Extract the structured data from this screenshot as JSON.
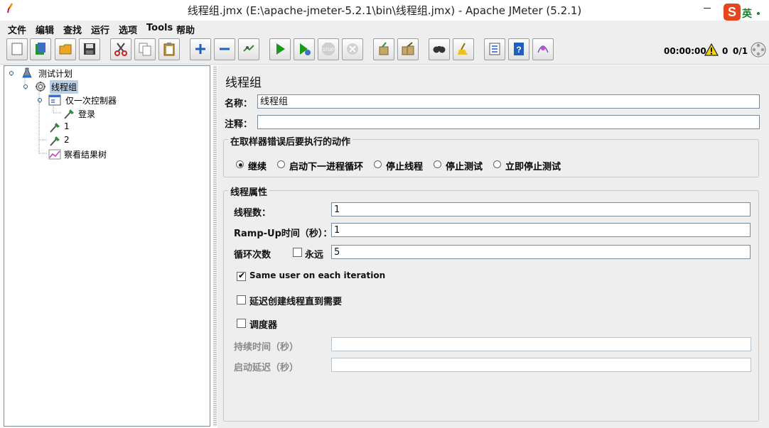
{
  "window": {
    "title": "线程组.jmx (E:\\apache-jmeter-5.2.1\\bin\\线程组.jmx) - Apache JMeter (5.2.1)",
    "ime_label": "英"
  },
  "menu": [
    "文件",
    "编辑",
    "查找",
    "运行",
    "选项",
    "Tools",
    "帮助"
  ],
  "status": {
    "elapsed": "00:00:00",
    "error_count": "0",
    "threads": "0/1"
  },
  "tree": [
    {
      "label": "测试计划"
    },
    {
      "label": "线程组",
      "selected": true
    },
    {
      "label": "仅一次控制器"
    },
    {
      "label": "登录"
    },
    {
      "label": "1"
    },
    {
      "label": "2"
    },
    {
      "label": "察看结果树"
    }
  ],
  "panel": {
    "title": "线程组",
    "name_label": "名称：",
    "name_value": "线程组",
    "comment_label": "注释：",
    "comment_value": "",
    "error_group_title": "在取样器错误后要执行的动作",
    "error_actions": [
      {
        "label": "继续",
        "selected": true
      },
      {
        "label": "启动下一进程循环",
        "selected": false
      },
      {
        "label": "停止线程",
        "selected": false
      },
      {
        "label": "停止测试",
        "selected": false
      },
      {
        "label": "立即停止测试",
        "selected": false
      }
    ],
    "props_group_title": "线程属性",
    "thread_count_label": "线程数：",
    "thread_count_value": "1",
    "rampup_label": "Ramp-Up时间（秒）：",
    "rampup_value": "1",
    "loop_label": "循环次数",
    "forever_label": "永远",
    "forever_checked": false,
    "loop_value": "5",
    "same_user_label": "Same user on each iteration",
    "same_user_checked": true,
    "delay_label": "延迟创建线程直到需要",
    "delay_checked": false,
    "scheduler_label": "调度器",
    "scheduler_checked": false,
    "duration_label": "持续时间（秒）",
    "duration_value": "",
    "startup_delay_label": "启动延迟（秒）",
    "startup_delay_value": ""
  },
  "toolbar_icons": [
    "new-icon",
    "templates-icon",
    "open-icon",
    "save-icon",
    "cut-icon",
    "copy-icon",
    "paste-icon",
    "expand-icon",
    "collapse-icon",
    "toggle-icon",
    "start-icon",
    "start-no-pause-icon",
    "stop-icon",
    "shutdown-icon",
    "clear-icon",
    "clear-all-icon",
    "search-icon",
    "reset-search-icon",
    "function-helper-icon",
    "help-icon",
    "remote-icon"
  ],
  "colors": {
    "accent_green": "#1a9a1a",
    "selection": "#b8cfe5",
    "warning": "#f5d21a"
  }
}
